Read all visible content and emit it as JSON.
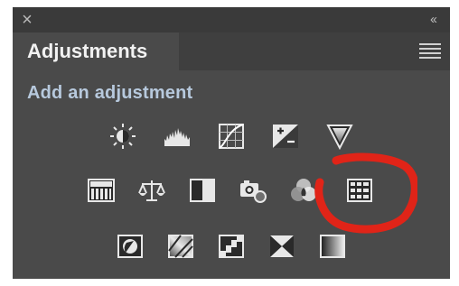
{
  "window": {
    "close_glyph": "×",
    "collapse_glyph": "‹‹"
  },
  "tab": {
    "label": "Adjustments"
  },
  "section": {
    "title": "Add an adjustment"
  },
  "adjustment_icons": {
    "row1": [
      "brightness-contrast-icon",
      "levels-icon",
      "curves-icon",
      "exposure-icon",
      "vibrance-icon"
    ],
    "row2": [
      "hue-saturation-icon",
      "color-balance-icon",
      "black-white-icon",
      "photo-filter-icon",
      "channel-mixer-icon",
      "color-lookup-icon"
    ],
    "row3": [
      "invert-icon",
      "posterize-icon",
      "threshold-icon",
      "selective-color-icon",
      "gradient-map-icon"
    ]
  },
  "colors": {
    "panel_bg": "#4a4a4a",
    "title_text": "#f2f2f2",
    "section_text": "#b7c9dd",
    "highlight": "#e02418"
  }
}
